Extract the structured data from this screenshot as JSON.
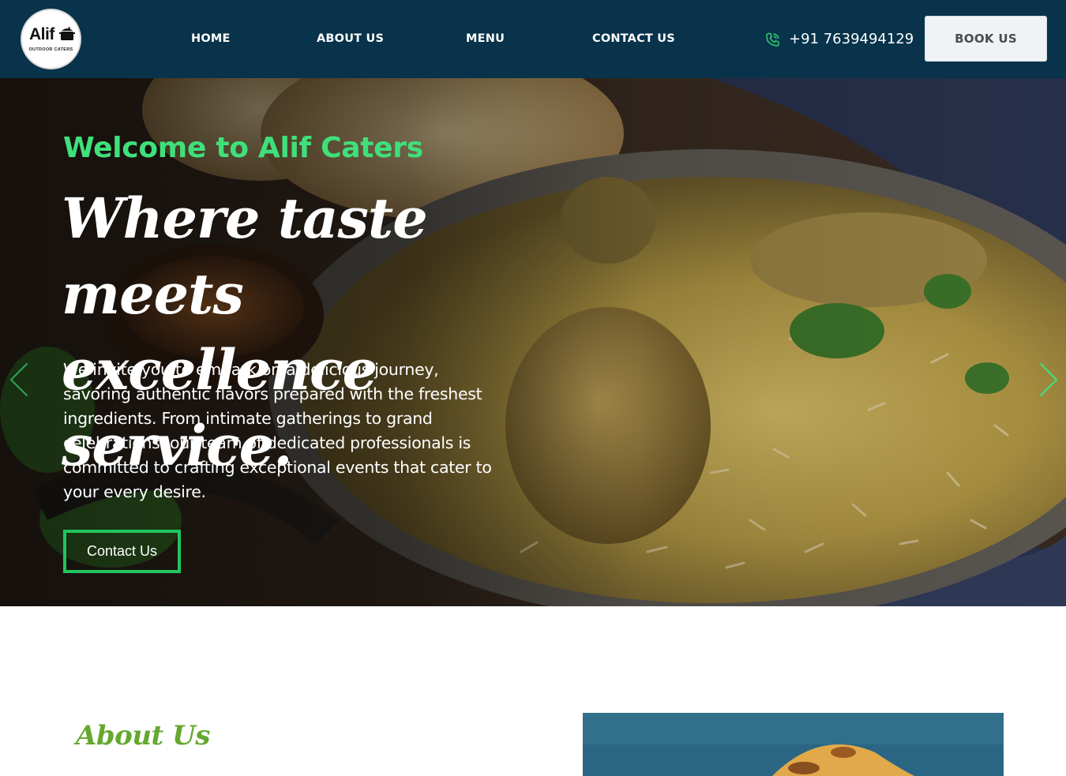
{
  "brand": {
    "logo_word": "Alif",
    "logo_sub": "OUTDOOR CATERS",
    "logo_icon": "cooking-pot-icon"
  },
  "nav": {
    "items": [
      {
        "label": "HOME"
      },
      {
        "label": "ABOUT US"
      },
      {
        "label": "MENU"
      },
      {
        "label": "CONTACT US"
      }
    ],
    "phone_icon": "phone-icon",
    "phone": "+91 7639494129",
    "book_label": "BOOK US"
  },
  "hero": {
    "welcome": "Welcome to Alif Caters",
    "tagline_line1": "Where taste meets",
    "tagline_line2": "excellence service.",
    "intro": "We invite you to embark on a delicious journey, savoring authentic flavors prepared with the freshest ingredients. From intimate gatherings to grand celebrations, our team of dedicated professionals is committed to crafting exceptional events that cater to your every desire.",
    "cta_label": "Contact Us",
    "prev_icon": "chevron-left-icon",
    "next_icon": "chevron-right-icon"
  },
  "about": {
    "heading": "About Us"
  },
  "colors": {
    "header_bg": "#08334a",
    "accent_green": "#3fe07a",
    "button_border": "#22c55e",
    "about_heading": "#65a82f"
  }
}
